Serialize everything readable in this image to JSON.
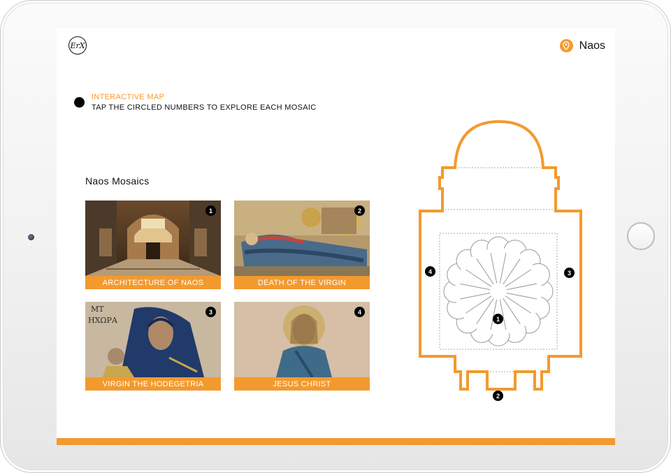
{
  "header": {
    "logo_text": "ErX",
    "location_label": "Naos",
    "location_icon": "map-pin-icon"
  },
  "intro": {
    "title": "INTERACTIVE MAP",
    "subtitle": "TAP THE CIRCLED NUMBERS TO EXPLORE EACH MOSAIC"
  },
  "section": {
    "title": "Naos Mosaics"
  },
  "cards": [
    {
      "number": "1",
      "label": "ARCHITECTURE OF NAOS"
    },
    {
      "number": "2",
      "label": "DEATH OF THE VIRGIN"
    },
    {
      "number": "3",
      "label": "VIRGIN THE HODEGETRIA"
    },
    {
      "number": "4",
      "label": "JESUS CHRIST"
    }
  ],
  "map": {
    "markers": [
      "1",
      "2",
      "3",
      "4"
    ]
  },
  "colors": {
    "accent": "#f39a2e",
    "text": "#111111",
    "marker": "#000000"
  }
}
